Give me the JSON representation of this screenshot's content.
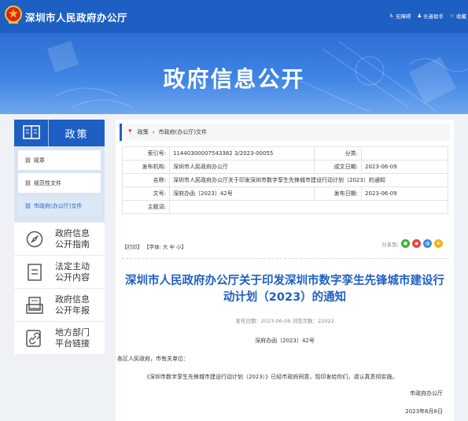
{
  "header": {
    "site_name": "深圳市人民政府办公厅",
    "tools": [
      "无障碍",
      "长者助手",
      "收藏"
    ]
  },
  "banner": {
    "title": "政府信息公开"
  },
  "sidebar": {
    "heading": "政策",
    "items": [
      {
        "label": "规章",
        "active": false
      },
      {
        "label": "规范性文件",
        "active": false
      },
      {
        "label": "市政府(办公厅)文件",
        "active": true
      }
    ],
    "links": [
      {
        "line1": "政府信息",
        "line2": "公开指南",
        "icon": "compass-icon"
      },
      {
        "line1": "法定主动",
        "line2": "公开内容",
        "icon": "document-icon"
      },
      {
        "line1": "政府信息",
        "line2": "公开年报",
        "icon": "report-icon"
      },
      {
        "line1": "地方部门",
        "line2": "平台链接",
        "icon": "link-icon"
      }
    ]
  },
  "breadcrumb": {
    "items": [
      "政策",
      "市政府(办公厅)文件"
    ]
  },
  "meta": {
    "index_label": "索引号:",
    "index_value": "11440300007543382 3/2023-00055",
    "category_label": "分类:",
    "category_value": "",
    "issuer_label": "发布机构:",
    "issuer_value": "深圳市人民政府办公厅",
    "created_label": "成文日期:",
    "created_value": "2023-06-09",
    "name_label": "名称:",
    "name_value": "深圳市人民政府办公厅关于印发深圳市数字孪生先锋城市建设行动计划（2023）的通知",
    "docno_label": "文号:",
    "docno_value": "深府办函〔2023〕42号",
    "published_label": "发布日期:",
    "published_value": "2023-06-09",
    "subject_label": "主题词:",
    "subject_value": ""
  },
  "actions": {
    "print": "【打印】",
    "font_label": "【字体:",
    "sizes": [
      "大",
      "中",
      "小"
    ],
    "font_close": "】"
  },
  "share": {
    "label": "分享到:"
  },
  "article": {
    "title": "深圳市人民政府办公厅关于印发深圳市数字孪生先锋城市建设行动计划（2023）的通知",
    "publish_line": "发布日期：2023-06-09 浏览次数：22022",
    "doc_number": "深府办函〔2023〕42号",
    "addressee": "各区人民政府，市有关单位：",
    "body": "《深圳市数字孪生先锋城市建设行动计划（2023）》已经市政府同意，现印发给你们，请认真贯彻实施。",
    "signature": "市政府办公厅",
    "date": "2023年6月8日"
  }
}
